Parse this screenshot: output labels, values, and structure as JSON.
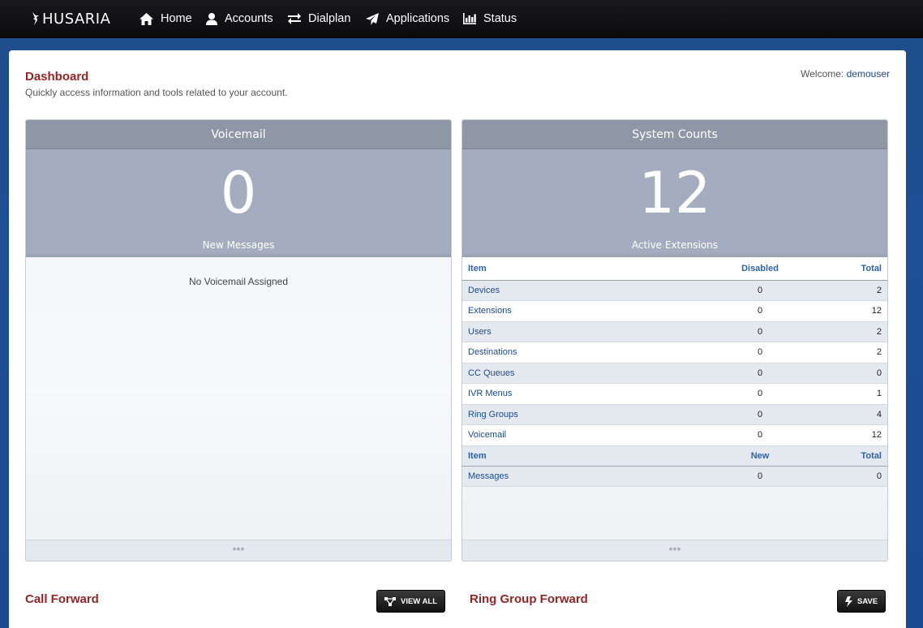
{
  "brand": "HUSARIA",
  "nav": [
    {
      "label": "Home",
      "icon": "home-icon"
    },
    {
      "label": "Accounts",
      "icon": "user-icon"
    },
    {
      "label": "Dialplan",
      "icon": "exchange-icon"
    },
    {
      "label": "Applications",
      "icon": "paper-plane-icon"
    },
    {
      "label": "Status",
      "icon": "bar-chart-icon"
    }
  ],
  "page": {
    "title": "Dashboard",
    "subtitle": "Quickly access information and tools related to your account.",
    "welcome_label": "Welcome:",
    "username": "demouser"
  },
  "voicemail_widget": {
    "title": "Voicemail",
    "count": "0",
    "count_label": "New Messages",
    "empty_message": "No Voicemail Assigned",
    "footer": "•••"
  },
  "system_counts_widget": {
    "title": "System Counts",
    "count": "12",
    "count_label": "Active Extensions",
    "headers": {
      "item": "Item",
      "disabled": "Disabled",
      "total": "Total"
    },
    "rows": [
      {
        "item": "Devices",
        "disabled": "0",
        "total": "2"
      },
      {
        "item": "Extensions",
        "disabled": "0",
        "total": "12"
      },
      {
        "item": "Users",
        "disabled": "0",
        "total": "2"
      },
      {
        "item": "Destinations",
        "disabled": "0",
        "total": "2"
      },
      {
        "item": "CC Queues",
        "disabled": "0",
        "total": "0"
      },
      {
        "item": "IVR Menus",
        "disabled": "0",
        "total": "1"
      },
      {
        "item": "Ring Groups",
        "disabled": "0",
        "total": "4"
      },
      {
        "item": "Voicemail",
        "disabled": "0",
        "total": "12"
      }
    ],
    "headers2": {
      "item": "Item",
      "new": "New",
      "total": "Total"
    },
    "rows2": [
      {
        "item": "Messages",
        "new": "0",
        "total": "0"
      }
    ],
    "footer": "•••"
  },
  "call_forward": {
    "title": "Call Forward",
    "button": "VIEW ALL"
  },
  "ring_group_forward": {
    "title": "Ring Group Forward",
    "button": "SAVE"
  },
  "colors": {
    "accent_red": "#952424",
    "link_blue": "#1c4a8f",
    "header_gray": "#8f97a7"
  }
}
